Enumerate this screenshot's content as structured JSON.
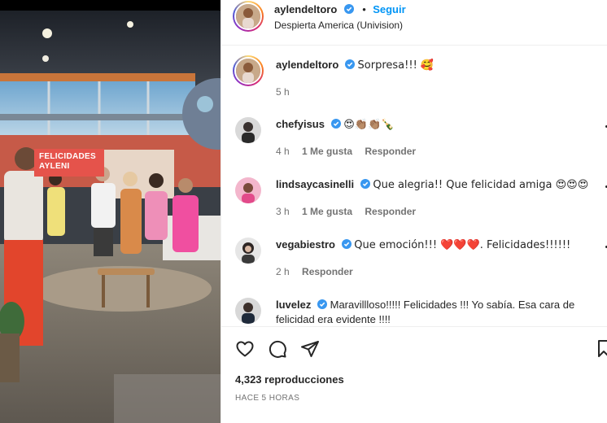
{
  "post": {
    "author": "aylendeltoro",
    "follow_label": "Seguir",
    "location": "Despierta America (Univision)",
    "views_text": "4,323 reproducciones",
    "time_ago": "HACE 5 HORAS"
  },
  "media": {
    "banner_line1": "FELICIDADES",
    "banner_line2": "AYLENI"
  },
  "caption": {
    "username": "aylendeltoro",
    "text": "Sorpresa!!! 🥰",
    "time": "5 h"
  },
  "comments": [
    {
      "username": "chefyisus",
      "verified": true,
      "text": "😍👏🏽👏🏽🍾",
      "time": "4 h",
      "likes": "1 Me gusta",
      "reply": "Responder"
    },
    {
      "username": "lindsaycasinelli",
      "verified": true,
      "text": "Que alegria!! Que felicidad amiga 😍😍😍",
      "time": "3 h",
      "likes": "1 Me gusta",
      "reply": "Responder"
    },
    {
      "username": "vegabiestro",
      "verified": true,
      "text": "Que emoción!!! ❤️❤️❤️. Felicidades!!!!!!",
      "time": "2 h",
      "likes": "",
      "reply": "Responder"
    },
    {
      "username": "luvelez",
      "verified": true,
      "text": "Maravillloso!!!!! Felicidades !!! Yo sabía. Esa cara de felicidad era evidente !!!!",
      "time": "",
      "likes": "",
      "reply": ""
    }
  ],
  "icons": {
    "like": "heart-icon",
    "comment": "comment-icon",
    "share": "paper-plane-icon",
    "save": "bookmark-icon",
    "verified": "verified-badge-icon"
  },
  "colors": {
    "accent": "#0095f6",
    "verified": "#3897f0",
    "muted_text": "#737373",
    "border": "#efefef"
  }
}
